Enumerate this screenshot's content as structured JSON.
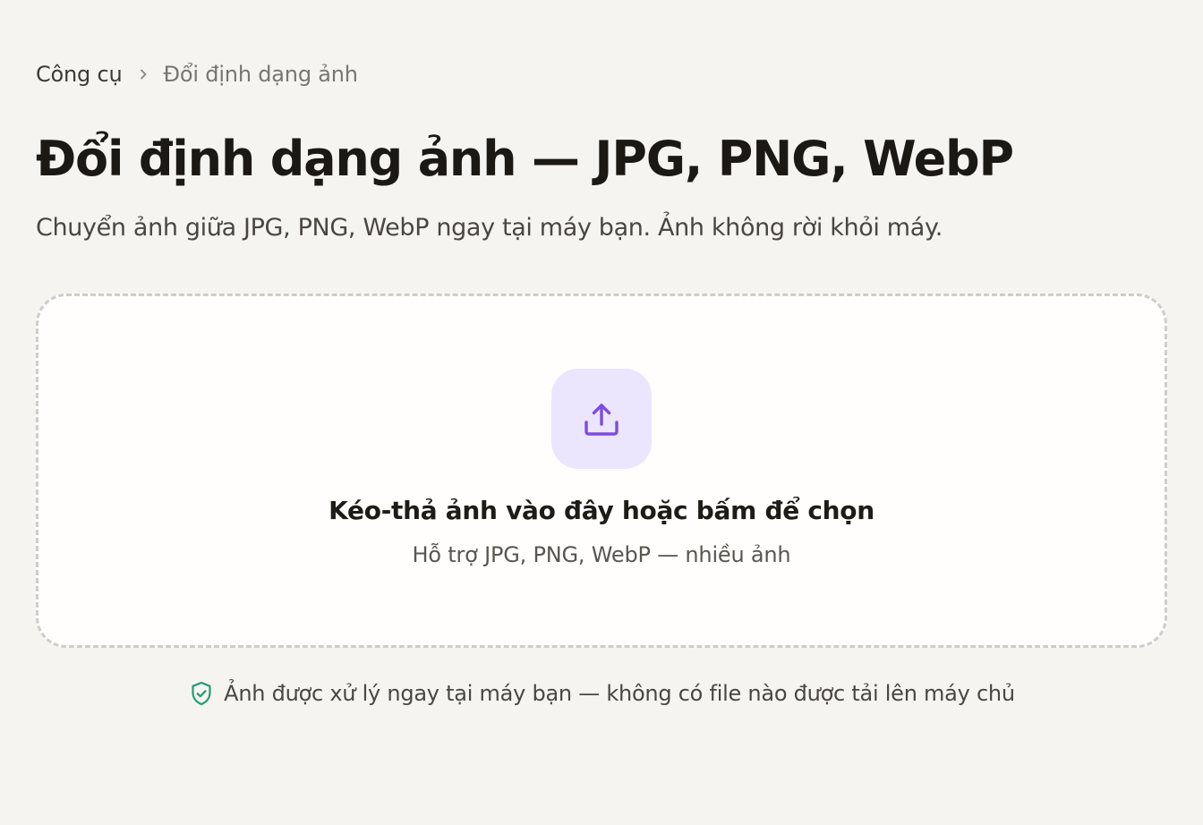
{
  "breadcrumb": {
    "root": "Công cụ",
    "current": "Đổi định dạng ảnh"
  },
  "page": {
    "title": "Đổi định dạng ảnh — JPG, PNG, WebP",
    "subtitle": "Chuyển ảnh giữa JPG, PNG, WebP ngay tại máy bạn. Ảnh không rời khỏi máy."
  },
  "dropzone": {
    "icon": "upload-icon",
    "title": "Kéo-thả ảnh vào đây hoặc bấm để chọn",
    "hint": "Hỗ trợ JPG, PNG, WebP — nhiều ảnh"
  },
  "privacy": {
    "icon": "shield-check-icon",
    "text": "Ảnh được xử lý ngay tại máy bạn — không có file nào được tải lên máy chủ"
  },
  "colors": {
    "background": "#f5f4f1",
    "accent": "#7c4ddf",
    "upload_tile": "#ebe6fd",
    "shield": "#239b75"
  }
}
